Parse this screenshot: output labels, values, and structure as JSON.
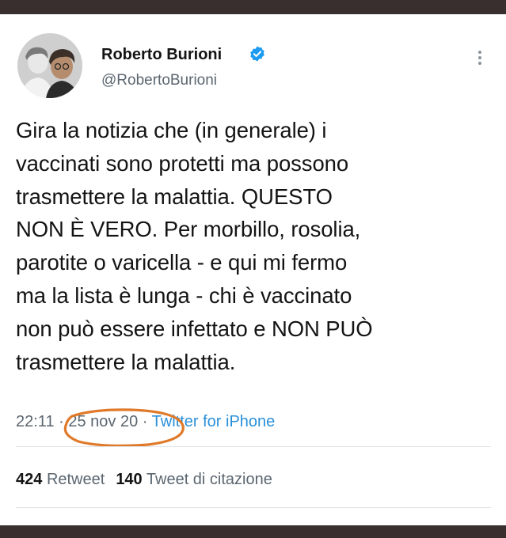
{
  "tweet": {
    "author": {
      "name": "Roberto Burioni",
      "handle": "@RobertoBurioni",
      "verified": true,
      "avatar_icon": "profile-photo"
    },
    "text_lines": [
      "Gira la notizia che (in generale) i",
      "vaccinati sono protetti ma possono",
      "trasmettere la malattia. QUESTO",
      "NON È VERO. Per morbillo, rosolia,",
      "parotite o varicella - e qui mi fermo",
      "ma la lista è lunga - chi è vaccinato",
      "non può essere infettato e NON PUÒ",
      "trasmettere la malattia."
    ],
    "time": "22:11",
    "separator": "·",
    "date": "25 nov 20",
    "source": "Twitter for iPhone",
    "retweets": {
      "count": "424",
      "label": "Retweet"
    },
    "quotes": {
      "count": "140",
      "label": "Tweet di citazione"
    }
  },
  "colors": {
    "verified_badge": "#1d9bf0",
    "link": "#2a90d9",
    "annotation_circle": "#e07a2a",
    "frame": "#3a2f2f"
  }
}
